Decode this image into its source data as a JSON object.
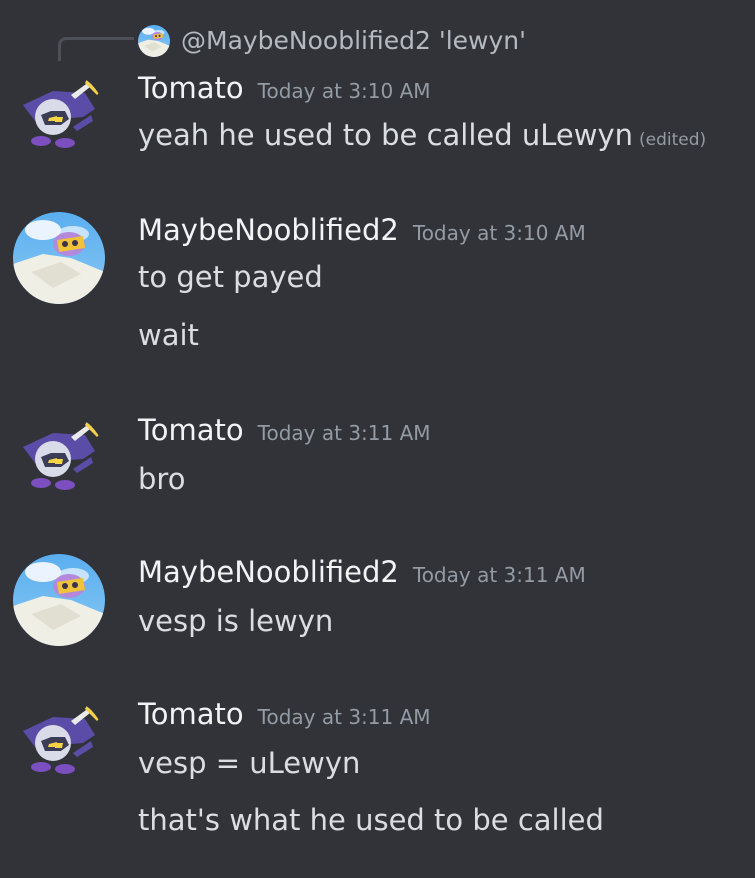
{
  "reply": {
    "text": "@MaybeNooblified2 'lewyn'"
  },
  "messages": [
    {
      "author": "Tomato",
      "timestamp": "Today at 3:10 AM",
      "lines": [
        "yeah he used to be called uLewyn"
      ],
      "edited_label": "(edited)"
    },
    {
      "author": "MaybeNooblified2",
      "timestamp": "Today at 3:10 AM",
      "lines": [
        "to get payed",
        "wait"
      ]
    },
    {
      "author": "Tomato",
      "timestamp": "Today at 3:11 AM",
      "lines": [
        "bro"
      ]
    },
    {
      "author": "MaybeNooblified2",
      "timestamp": "Today at 3:11 AM",
      "lines": [
        "vesp is lewyn"
      ]
    },
    {
      "author": "Tomato",
      "timestamp": "Today at 3:11 AM",
      "lines": [
        "vesp = uLewyn",
        "that's what he used to be called"
      ]
    }
  ],
  "colors": {
    "background": "#313338",
    "username": "#f2f3f5",
    "message_text": "#dbdee1",
    "timestamp": "#949ba4",
    "reply_spine": "#4e5058"
  }
}
